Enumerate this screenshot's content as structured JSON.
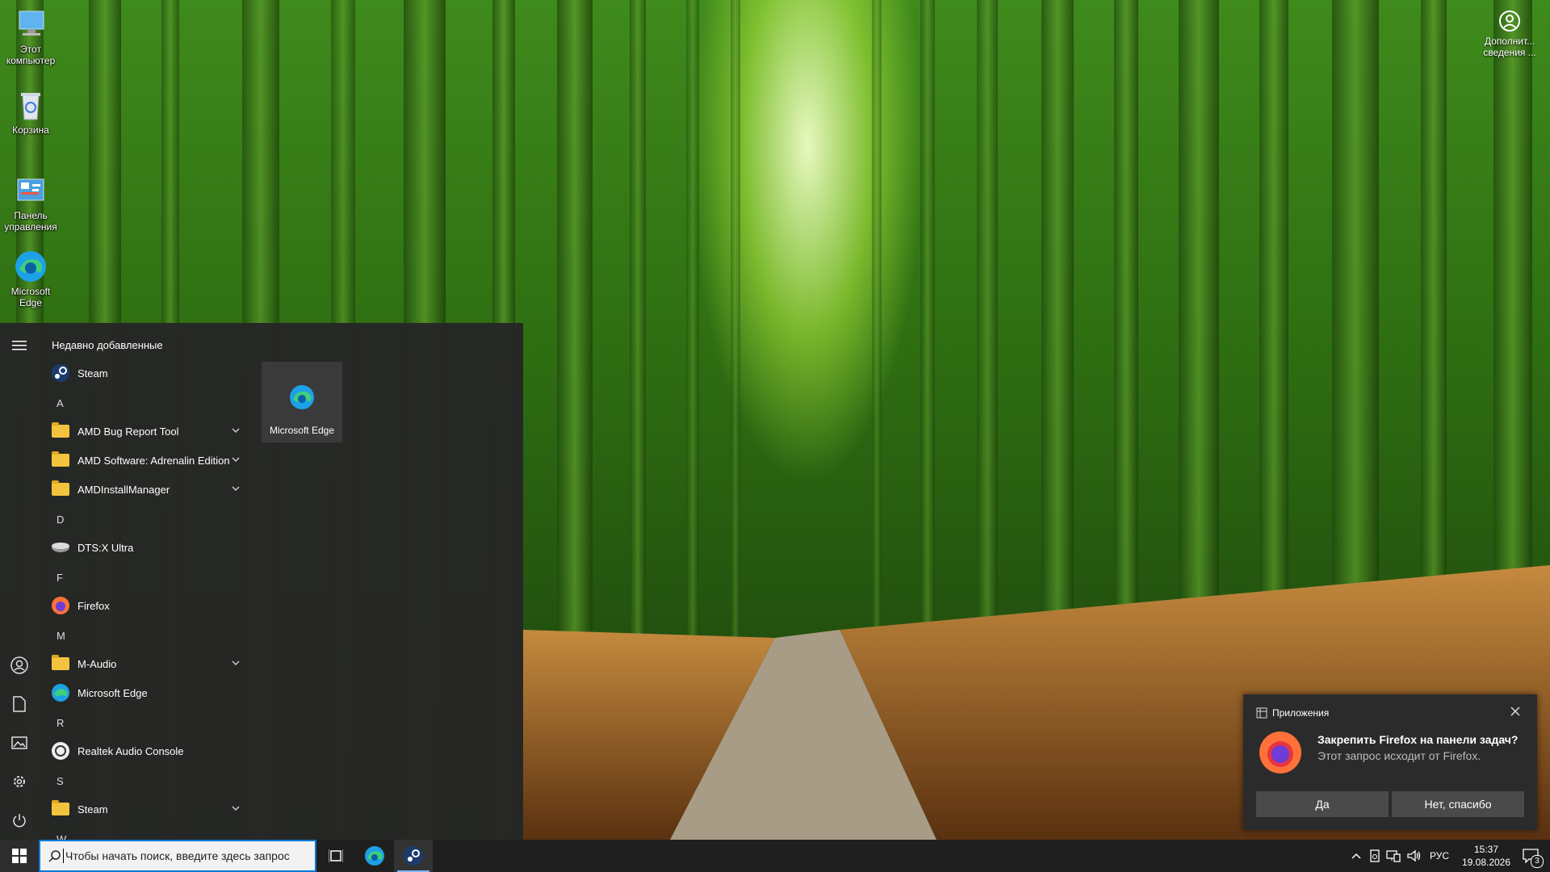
{
  "desktop": {
    "icons": [
      {
        "label": "Этот компьютер",
        "icon": "computer-icon"
      },
      {
        "label": "Корзина",
        "icon": "recycle-bin-icon"
      },
      {
        "label": "Панель управления",
        "icon": "control-panel-icon"
      },
      {
        "label": "Microsoft Edge",
        "icon": "edge-icon"
      }
    ],
    "info_button": {
      "label": "Дополнит... сведения ...",
      "icon": "user-circle-icon"
    }
  },
  "start_menu": {
    "section_title": "Недавно добавленные",
    "recent": [
      {
        "label": "Steam",
        "icon": "steam-icon"
      }
    ],
    "letters": [
      "A",
      "D",
      "F",
      "M",
      "R",
      "S",
      "W"
    ],
    "apps": [
      {
        "label": "AMD Bug Report Tool",
        "icon": "folder-icon",
        "expandable": true
      },
      {
        "label": "AMD Software: Adrenalin Edition",
        "icon": "folder-icon",
        "expandable": true
      },
      {
        "label": "AMDInstallManager",
        "icon": "folder-icon",
        "expandable": true
      },
      {
        "label": "DTS:X Ultra",
        "icon": "dts-icon",
        "expandable": false
      },
      {
        "label": "Firefox",
        "icon": "firefox-icon",
        "expandable": false
      },
      {
        "label": "M-Audio",
        "icon": "folder-icon",
        "expandable": true
      },
      {
        "label": "Microsoft Edge",
        "icon": "edge-icon",
        "expandable": false
      },
      {
        "label": "Realtek Audio Console",
        "icon": "realtek-icon",
        "expandable": false
      },
      {
        "label": "Steam",
        "icon": "folder-icon",
        "expandable": true
      }
    ],
    "tile": {
      "label": "Microsoft Edge",
      "icon": "edge-icon"
    },
    "rail": [
      "menu-icon",
      "user-icon",
      "documents-icon",
      "pictures-icon",
      "settings-icon",
      "power-icon"
    ]
  },
  "taskbar": {
    "search_placeholder": "Чтобы начать поиск, введите здесь запрос",
    "language": "РУС",
    "time": "15:37",
    "date": "19.08.2026",
    "notification_count": "3"
  },
  "toast": {
    "app": "Приложения",
    "title": "Закрепить Firefox на панели задач?",
    "subtitle": "Этот запрос исходит от Firefox.",
    "yes": "Да",
    "no": "Нет, спасибо"
  }
}
